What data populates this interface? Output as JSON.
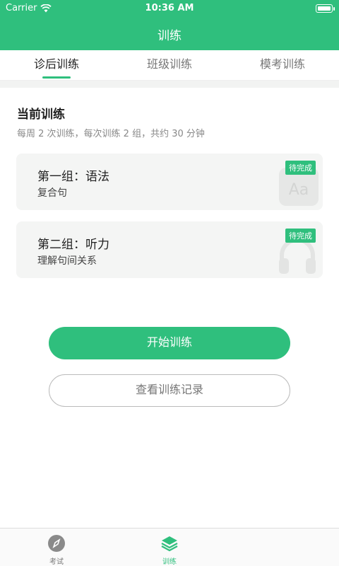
{
  "status_bar": {
    "carrier": "Carrier",
    "time": "10:36 AM"
  },
  "nav": {
    "title": "训练"
  },
  "tabs": [
    {
      "label": "诊后训练",
      "active": true
    },
    {
      "label": "班级训练",
      "active": false
    },
    {
      "label": "模考训练",
      "active": false
    }
  ],
  "current": {
    "title": "当前训练",
    "subtitle": "每周 2 次训练，每次训练 2 组，共约 30 分钟"
  },
  "cards": [
    {
      "title": "第一组：语法",
      "subtitle": "复合句",
      "badge": "待完成",
      "icon": "font-aa-icon"
    },
    {
      "title": "第二组：听力",
      "subtitle": "理解句间关系",
      "badge": "待完成",
      "icon": "headphones-icon"
    }
  ],
  "buttons": {
    "start": "开始训练",
    "history": "查看训练记录"
  },
  "tabbar": [
    {
      "label": "考试",
      "icon": "compass-icon"
    },
    {
      "label": "训练",
      "icon": "layers-icon"
    }
  ],
  "colors": {
    "accent": "#2fbf7d",
    "card_bg": "#f4f5f4"
  }
}
